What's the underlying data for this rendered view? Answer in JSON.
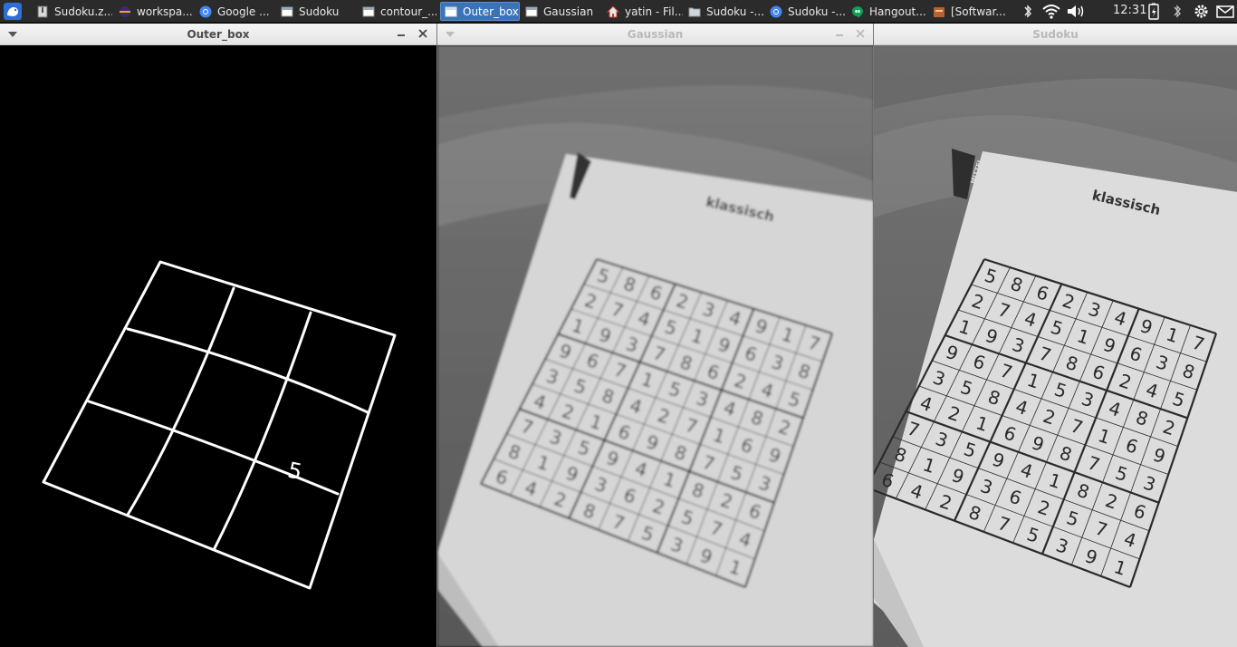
{
  "panel": {
    "tasks": [
      {
        "label": "Sudoku.z...",
        "icon": "archive-icon"
      },
      {
        "label": "workspa...",
        "icon": "eclipse-icon"
      },
      {
        "label": "Google ...",
        "icon": "chrome-icon"
      },
      {
        "label": "Sudoku",
        "icon": "window-icon"
      },
      {
        "label": "contour_...",
        "icon": "window-icon"
      },
      {
        "label": "Outer_box",
        "icon": "window-icon"
      },
      {
        "label": "Gaussian",
        "icon": "window-icon"
      },
      {
        "label": "yatin - Fil...",
        "icon": "home-folder-icon"
      },
      {
        "label": "Sudoku -...",
        "icon": "folder-icon"
      },
      {
        "label": "Sudoku -...",
        "icon": "chrome-icon"
      },
      {
        "label": "Hangout...",
        "icon": "hangouts-icon"
      },
      {
        "label": "[Softwar...",
        "icon": "software-center-icon"
      }
    ],
    "clock": "12:31"
  },
  "windows": {
    "outer_box": {
      "title": "Outer_box",
      "digit": "5"
    },
    "gaussian": {
      "title": "Gaussian"
    },
    "sudoku": {
      "title": "Sudoku"
    }
  },
  "book": {
    "heading": "klassisch",
    "tag": "MITTEL",
    "grid_rows": [
      [
        "5",
        "8",
        "6",
        "2",
        "3",
        "4",
        "9",
        "1",
        "7"
      ],
      [
        "2",
        "7",
        "4",
        "5",
        "1",
        "9",
        "6",
        "3",
        "8"
      ],
      [
        "1",
        "9",
        "3",
        "7",
        "8",
        "6",
        "2",
        "4",
        "5"
      ],
      [
        "9",
        "6",
        "7",
        "1",
        "5",
        "3",
        "4",
        "8",
        "2"
      ],
      [
        "3",
        "5",
        "8",
        "4",
        "2",
        "7",
        "1",
        "6",
        "9"
      ],
      [
        "4",
        "2",
        "1",
        "6",
        "9",
        "8",
        "7",
        "5",
        "3"
      ],
      [
        "7",
        "3",
        "5",
        "9",
        "4",
        "1",
        "8",
        "2",
        "6"
      ],
      [
        "8",
        "1",
        "9",
        "3",
        "6",
        "2",
        "5",
        "7",
        "4"
      ],
      [
        "6",
        "4",
        "2",
        "8",
        "7",
        "5",
        "3",
        "9",
        "1"
      ]
    ]
  },
  "colors": {
    "panel_bg": "#2b2b2b",
    "active_task": "#3b73b9",
    "titlebar": "#ececec"
  }
}
